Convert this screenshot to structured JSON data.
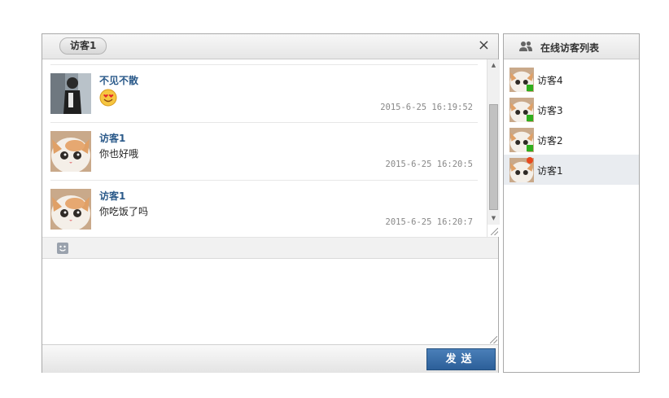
{
  "chat": {
    "tab_label": "访客1",
    "close_label": "×",
    "messages": [
      {
        "sender": "不见不散",
        "text": "",
        "emoji": "heart-eyes",
        "time": "2015-6-25 16:19:52"
      },
      {
        "sender": "访客1",
        "text": "你也好哦",
        "time": "2015-6-25 16:20:5"
      },
      {
        "sender": "访客1",
        "text": "你吃饭了吗",
        "time": "2015-6-25 16:20:7"
      }
    ],
    "send_label": "发送"
  },
  "visitors": {
    "title": "在线访客列表",
    "items": [
      {
        "name": "访客4",
        "status": "online"
      },
      {
        "name": "访客3",
        "status": "online"
      },
      {
        "name": "访客2",
        "status": "online"
      },
      {
        "name": "访客1",
        "status": "away",
        "active": true
      }
    ]
  },
  "colors": {
    "accent": "#2c5f99",
    "sender_name": "#2b5a8a",
    "online": "#2fae1d",
    "away": "#e8491d"
  }
}
